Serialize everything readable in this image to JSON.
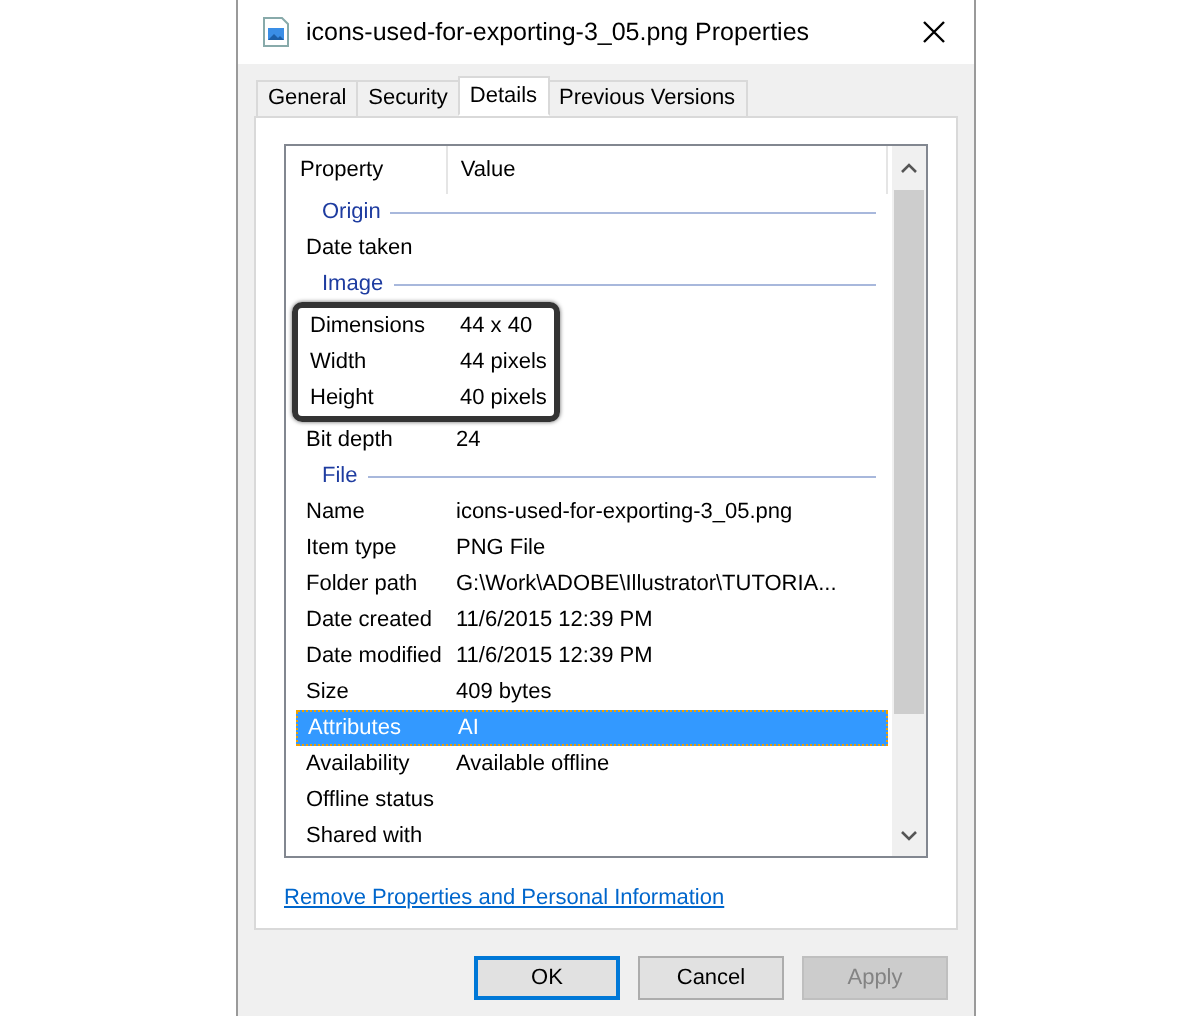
{
  "window": {
    "title": "icons-used-for-exporting-3_05.png Properties"
  },
  "tabs": [
    {
      "label": "General",
      "selected": false
    },
    {
      "label": "Security",
      "selected": false
    },
    {
      "label": "Details",
      "selected": true
    },
    {
      "label": "Previous Versions",
      "selected": false
    }
  ],
  "list": {
    "columns": [
      "Property",
      "Value"
    ],
    "rows": [
      {
        "kind": "section",
        "label": "Origin"
      },
      {
        "kind": "property",
        "name": "Date taken",
        "value": "",
        "selected": false,
        "outlined": false
      },
      {
        "kind": "section",
        "label": "Image"
      },
      {
        "kind": "property",
        "name": "Dimensions",
        "value": "44 x 40",
        "selected": false,
        "outlined": true
      },
      {
        "kind": "property",
        "name": "Width",
        "value": "44 pixels",
        "selected": false,
        "outlined": true
      },
      {
        "kind": "property",
        "name": "Height",
        "value": "40 pixels",
        "selected": false,
        "outlined": true
      },
      {
        "kind": "property",
        "name": "Bit depth",
        "value": "24",
        "selected": false,
        "outlined": false
      },
      {
        "kind": "section",
        "label": "File"
      },
      {
        "kind": "property",
        "name": "Name",
        "value": "icons-used-for-exporting-3_05.png",
        "selected": false,
        "outlined": false
      },
      {
        "kind": "property",
        "name": "Item type",
        "value": "PNG File",
        "selected": false,
        "outlined": false
      },
      {
        "kind": "property",
        "name": "Folder path",
        "value": "G:\\Work\\ADOBE\\Illustrator\\TUTORIA...",
        "selected": false,
        "outlined": false
      },
      {
        "kind": "property",
        "name": "Date created",
        "value": "11/6/2015 12:39 PM",
        "selected": false,
        "outlined": false
      },
      {
        "kind": "property",
        "name": "Date modified",
        "value": "11/6/2015 12:39 PM",
        "selected": false,
        "outlined": false
      },
      {
        "kind": "property",
        "name": "Size",
        "value": "409 bytes",
        "selected": false,
        "outlined": false
      },
      {
        "kind": "property",
        "name": "Attributes",
        "value": "AI",
        "selected": true,
        "outlined": false
      },
      {
        "kind": "property",
        "name": "Availability",
        "value": "Available offline",
        "selected": false,
        "outlined": false
      },
      {
        "kind": "property",
        "name": "Offline status",
        "value": "",
        "selected": false,
        "outlined": false
      },
      {
        "kind": "property",
        "name": "Shared with",
        "value": "",
        "selected": false,
        "outlined": false
      }
    ]
  },
  "link": "Remove Properties and Personal Information",
  "buttons": [
    {
      "label": "OK",
      "disabled": false,
      "default": true
    },
    {
      "label": "Cancel",
      "disabled": false,
      "default": false
    },
    {
      "label": "Apply",
      "disabled": true,
      "default": false
    }
  ]
}
